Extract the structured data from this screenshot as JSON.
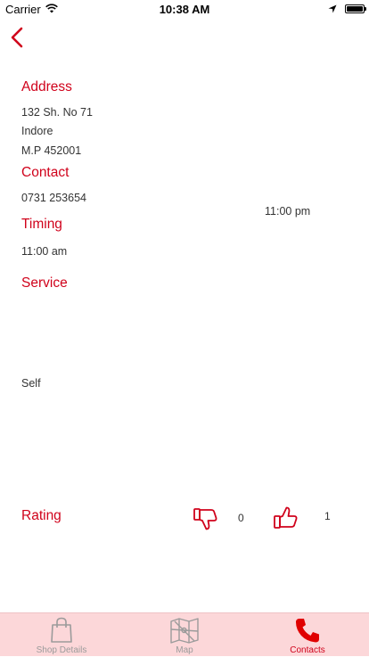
{
  "status_bar": {
    "carrier": "Carrier",
    "time": "10:38 AM"
  },
  "address": {
    "heading": "Address",
    "lines": [
      "132 Sh. No 71",
      "Indore",
      "M.P 452001"
    ]
  },
  "contact": {
    "heading": "Contact",
    "phone": "0731 253654"
  },
  "timing": {
    "heading": "Timing",
    "open": "11:00 am",
    "close": "11:00 pm"
  },
  "service": {
    "heading": "Service",
    "value": "Self"
  },
  "rating": {
    "heading": "Rating",
    "dislikes": "0",
    "likes": "1"
  },
  "tabs": [
    {
      "label": "Shop Details",
      "icon": "shopping-bag-icon",
      "active": false
    },
    {
      "label": "Map",
      "icon": "map-icon",
      "active": false
    },
    {
      "label": "Contacts",
      "icon": "phone-icon",
      "active": true
    }
  ],
  "colors": {
    "accent": "#d0021b",
    "tabbar_bg": "#fcd7d9",
    "inactive_tab": "#9b9b9b"
  }
}
